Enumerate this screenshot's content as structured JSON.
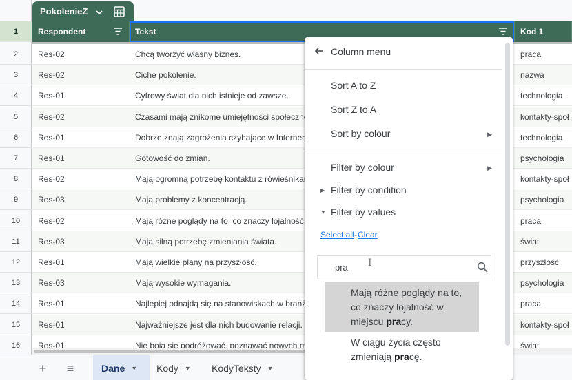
{
  "table": {
    "name": "PokolenieZ"
  },
  "columns": [
    "Respondent",
    "Tekst",
    "Kod 1"
  ],
  "header_row_number": "1",
  "rows": [
    {
      "n": "2",
      "respondent": "Res-02",
      "tekst": "Chcą tworzyć własny biznes.",
      "kod": "praca"
    },
    {
      "n": "3",
      "respondent": "Res-02",
      "tekst": "Ciche pokolenie.",
      "kod": "nazwa"
    },
    {
      "n": "4",
      "respondent": "Res-01",
      "tekst": "Cyfrowy świat dla nich istnieje od zawsze.",
      "kod": "technologia"
    },
    {
      "n": "5",
      "respondent": "Res-02",
      "tekst": "Czasami mają znikome umiejętności społeczne.",
      "kod": "kontakty-społ"
    },
    {
      "n": "6",
      "respondent": "Res-01",
      "tekst": "Dobrze znają zagrożenia czyhające w Internecie.",
      "kod": "technologia"
    },
    {
      "n": "7",
      "respondent": "Res-01",
      "tekst": "Gotowość do zmian.",
      "kod": "psychologia"
    },
    {
      "n": "8",
      "respondent": "Res-02",
      "tekst": "Mają ogromną potrzebę kontaktu z rówieśnikami.",
      "kod": "kontakty-społ"
    },
    {
      "n": "9",
      "respondent": "Res-03",
      "tekst": "Mają problemy z koncentracją.",
      "kod": "psychologia"
    },
    {
      "n": "10",
      "respondent": "Res-02",
      "tekst": "Mają różne poglądy na to, co znaczy lojalność.",
      "kod": "praca"
    },
    {
      "n": "11",
      "respondent": "Res-03",
      "tekst": "Mają silną potrzebę zmieniania świata.",
      "kod": "świat"
    },
    {
      "n": "12",
      "respondent": "Res-01",
      "tekst": "Mają wielkie plany na przyszłość.",
      "kod": "przyszłość"
    },
    {
      "n": "13",
      "respondent": "Res-03",
      "tekst": "Mają wysokie wymagania.",
      "kod": "psychologia"
    },
    {
      "n": "14",
      "respondent": "Res-01",
      "tekst": "Najlepiej odnajdą się na stanowiskach w branży.",
      "kod": "praca"
    },
    {
      "n": "15",
      "respondent": "Res-01",
      "tekst": "Najważniejsze jest dla nich budowanie relacji.",
      "kod": "kontakty-społ"
    },
    {
      "n": "16",
      "respondent": "Res-01",
      "tekst": "Nie boją się podróżować, poznawać nowych miejsc.",
      "kod": "świat"
    }
  ],
  "menu": {
    "title": "Column menu",
    "sort_az": "Sort A to Z",
    "sort_za": "Sort Z to A",
    "sort_colour": "Sort by colour",
    "filter_colour": "Filter by colour",
    "filter_condition": "Filter by condition",
    "filter_values": "Filter by values",
    "select_all": "Select all",
    "separator": "-",
    "clear": "Clear",
    "search_value": "pra",
    "options": [
      {
        "before": "Mają różne poglądy na to, co znaczy lojalność w miejscu ",
        "match": "pra",
        "after": "cy.",
        "highlighted": true
      },
      {
        "before": "W ciągu życia często zmieniają ",
        "match": "pra",
        "after": "cę.",
        "highlighted": false
      }
    ]
  },
  "sheets": {
    "add": "+",
    "all_sheets": "≡",
    "tabs": [
      {
        "label": "Dane",
        "active": true
      },
      {
        "label": "Kody",
        "active": false
      },
      {
        "label": "KodyTeksty",
        "active": false
      }
    ]
  },
  "colors": {
    "header_bg": "#3d6b57",
    "accent": "#1a73e8",
    "active_tab_bg": "#dde7f5"
  }
}
